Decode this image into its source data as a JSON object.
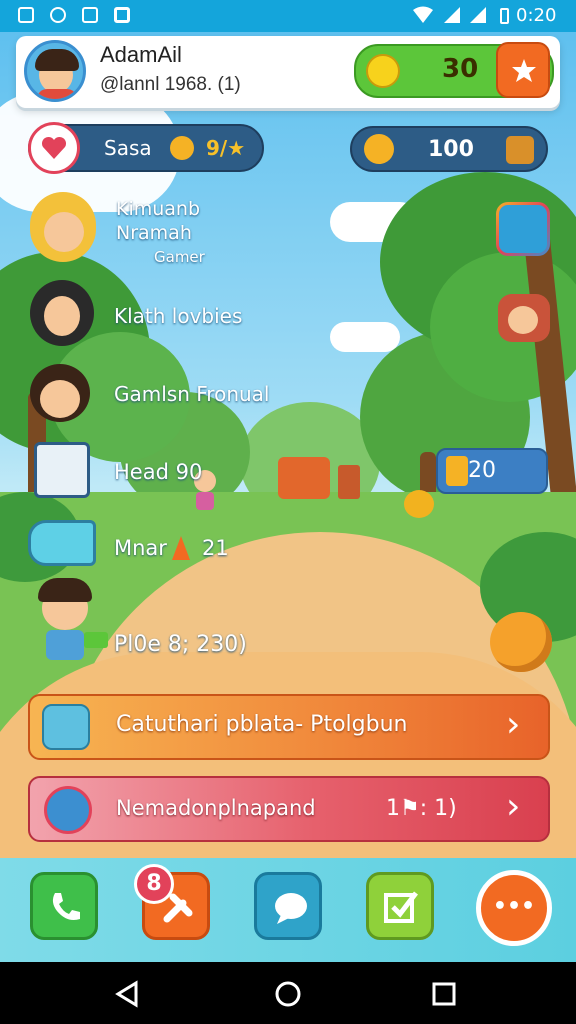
{
  "status_bar": {
    "time": "0:20"
  },
  "profile": {
    "name": "AdamAil",
    "handle": "@lannl 1968. (1)",
    "coins": "30"
  },
  "stats": {
    "left_label": "Sasa",
    "left_value": "9/★",
    "right_value": "100"
  },
  "friends": [
    {
      "line1": "Kimuanb",
      "line2": "Nramah",
      "line3": "Gamer"
    },
    {
      "line1": "Klath lovbies"
    },
    {
      "line1": "Gamlsn Fronual"
    },
    {
      "line1": "Head 90"
    },
    {
      "line1": "Mnar",
      "line2": "21"
    },
    {
      "line1": "Pl0e 8; 230)"
    }
  ],
  "reward_badge": {
    "value": "20"
  },
  "actions": [
    {
      "label": "Catuthari pblata- Ptolgbun",
      "chevron": "›"
    },
    {
      "label": "Nemadonplnapand",
      "extra": "1⚑: 1)",
      "chevron": "›"
    }
  ],
  "dock": {
    "badge": "8",
    "more_glyph": "•••"
  },
  "colors": {
    "status_bar": "#14a5db",
    "coin_pill": "#5cc63a",
    "orange": "#f26a22",
    "action_orange": "#f39a3c",
    "action_red": "#e64e5a",
    "dark_pill": "#2d5c86"
  }
}
